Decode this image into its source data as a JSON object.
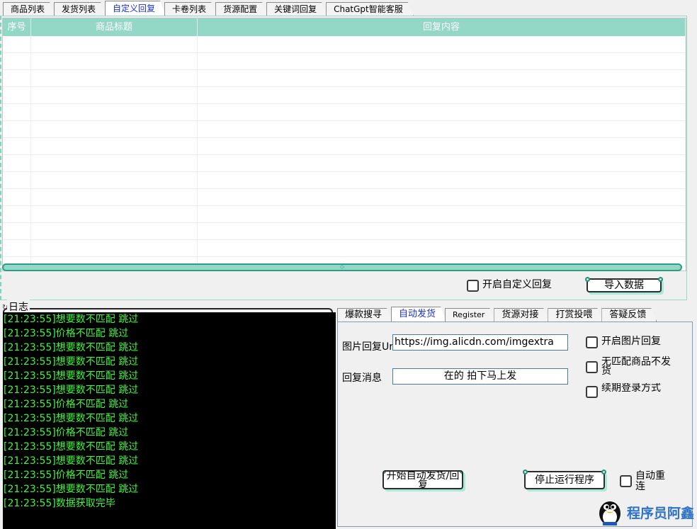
{
  "top_tabs": [
    {
      "label": "商品列表"
    },
    {
      "label": "发货列表"
    },
    {
      "label": "自定义回复",
      "active": true
    },
    {
      "label": "卡卷列表"
    },
    {
      "label": "货源配置"
    },
    {
      "label": "关键词回复"
    },
    {
      "label": "ChatGpt智能客服"
    }
  ],
  "grid": {
    "columns": [
      "序号",
      "商品标题",
      "回复内容"
    ]
  },
  "custom_reply": {
    "enable_label": "开启自定义回复",
    "import_button": "导入数据"
  },
  "log": {
    "title": "日志",
    "lines": [
      "[21:23:55]想要数不匹配 跳过",
      "[21:23:55]价格不匹配  跳过",
      "[21:23:55]想要数不匹配 跳过",
      "[21:23:55]想要数不匹配 跳过",
      "[21:23:55]想要数不匹配 跳过",
      "[21:23:55]想要数不匹配 跳过",
      "[21:23:55]价格不匹配  跳过",
      "[21:23:55]想要数不匹配 跳过",
      "[21:23:55]价格不匹配  跳过",
      "[21:23:55]想要数不匹配 跳过",
      "[21:23:55]想要数不匹配 跳过",
      "[21:23:55]价格不匹配  跳过",
      "[21:23:55]想要数不匹配 跳过",
      "[21:23:55]数据获取完毕"
    ]
  },
  "sub_tabs": [
    {
      "label": "爆款搜寻"
    },
    {
      "label": "自动发货",
      "active": true
    },
    {
      "label": "Register"
    },
    {
      "label": "货源对接"
    },
    {
      "label": "打赏投喂"
    },
    {
      "label": "答疑反馈"
    }
  ],
  "auto_ship": {
    "image_url_label": "图片回复Url",
    "image_url_value": "https://img.alicdn.com/imgextra",
    "reply_msg_label": "回复消息",
    "reply_msg_value": "在的 拍下马上发",
    "enable_image_reply": "开启图片回复",
    "no_match_no_ship": "无匹配商品不发货",
    "login_mode": "续期登录方式",
    "start_button": "开始自动发货/回复",
    "stop_button": "停止运行程序",
    "auto_reconnect": "自动重连"
  },
  "watermark": {
    "text": "程序员阿鑫"
  }
}
